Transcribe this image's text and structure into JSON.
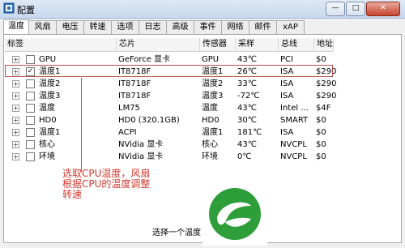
{
  "window": {
    "title": "配置",
    "min": "—",
    "max": "□",
    "close": "✕"
  },
  "tabs": [
    "温度",
    "风扇",
    "电压",
    "转速",
    "选项",
    "日志",
    "高级",
    "事件",
    "网络",
    "邮件",
    "xAP"
  ],
  "columns": [
    "标签",
    "芯片",
    "传感器",
    "采样",
    "总线",
    "地址"
  ],
  "rows": [
    {
      "label": "GPU",
      "chip": "GeForce 显卡",
      "sensor": "GPU",
      "sample": "43℃",
      "bus": "PCI",
      "addr": "$0",
      "checked": false
    },
    {
      "label": "温度1",
      "chip": "IT8718F",
      "sensor": "温度1",
      "sample": "26℃",
      "bus": "ISA",
      "addr": "$290",
      "checked": true
    },
    {
      "label": "温度2",
      "chip": "IT8718F",
      "sensor": "温度2",
      "sample": "33℃",
      "bus": "ISA",
      "addr": "$290",
      "checked": false
    },
    {
      "label": "温度3",
      "chip": "IT8718F",
      "sensor": "温度3",
      "sample": "-72℃",
      "bus": "ISA",
      "addr": "$290",
      "checked": false
    },
    {
      "label": "温度",
      "chip": "LM75",
      "sensor": "温度",
      "sample": "43℃",
      "bus": "Intel ...",
      "addr": "$4F",
      "checked": false
    },
    {
      "label": "HD0",
      "chip": "HD0 (320.1GB)",
      "sensor": "HD0",
      "sample": "30℃",
      "bus": "SMART",
      "addr": "$0",
      "checked": false
    },
    {
      "label": "温度1",
      "chip": "ACPI",
      "sensor": "温度1",
      "sample": "181℃",
      "bus": "ISA",
      "addr": "$0",
      "checked": false
    },
    {
      "label": "核心",
      "chip": "NVidia 显卡",
      "sensor": "核心",
      "sample": "43℃",
      "bus": "NVCPL",
      "addr": "$0",
      "checked": false
    },
    {
      "label": "环境",
      "chip": "NVidia 显卡",
      "sensor": "环境",
      "sample": "0℃",
      "bus": "NVCPL",
      "addr": "$0",
      "checked": false
    }
  ],
  "annotation": "选取CPU温度，风扇根据CPU的温度调整转速",
  "status": "选择一个温度",
  "colors": {
    "annotation": "#d33a2f",
    "logo_green": "#2e9e3a"
  },
  "icons": {
    "expander": "+",
    "check": "✓"
  }
}
